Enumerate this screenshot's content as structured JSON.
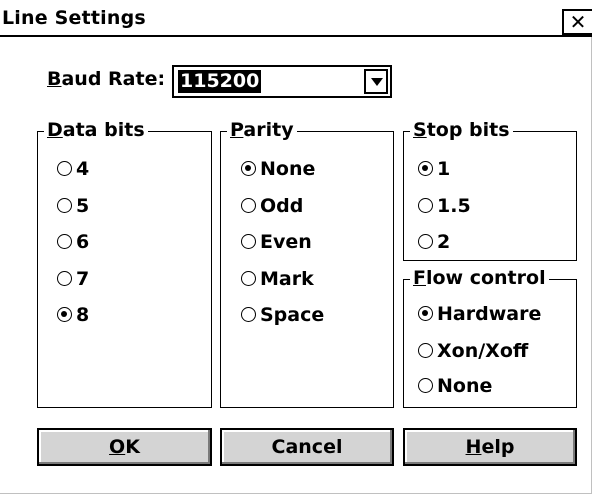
{
  "window": {
    "title": "Line Settings",
    "close_glyph": "✕"
  },
  "baud": {
    "label_u": "B",
    "label_rest": "aud Rate:",
    "value": "115200"
  },
  "data_bits": {
    "label_u": "D",
    "label_rest": "ata bits",
    "options": [
      "4",
      "5",
      "6",
      "7",
      "8"
    ],
    "selected": "8"
  },
  "parity": {
    "label_u": "P",
    "label_rest": "arity",
    "options": [
      "None",
      "Odd",
      "Even",
      "Mark",
      "Space"
    ],
    "selected": "None"
  },
  "stop_bits": {
    "label_u": "S",
    "label_rest": "top bits",
    "options": [
      "1",
      "1.5",
      "2"
    ],
    "selected": "1"
  },
  "flow_control": {
    "label_u": "F",
    "label_rest": "low control",
    "options": [
      "Hardware",
      "Xon/Xoff",
      "None"
    ],
    "selected": "Hardware"
  },
  "buttons": {
    "ok_u": "O",
    "ok_rest": "K",
    "cancel": "Cancel",
    "help_u": "H",
    "help_rest": "elp"
  }
}
